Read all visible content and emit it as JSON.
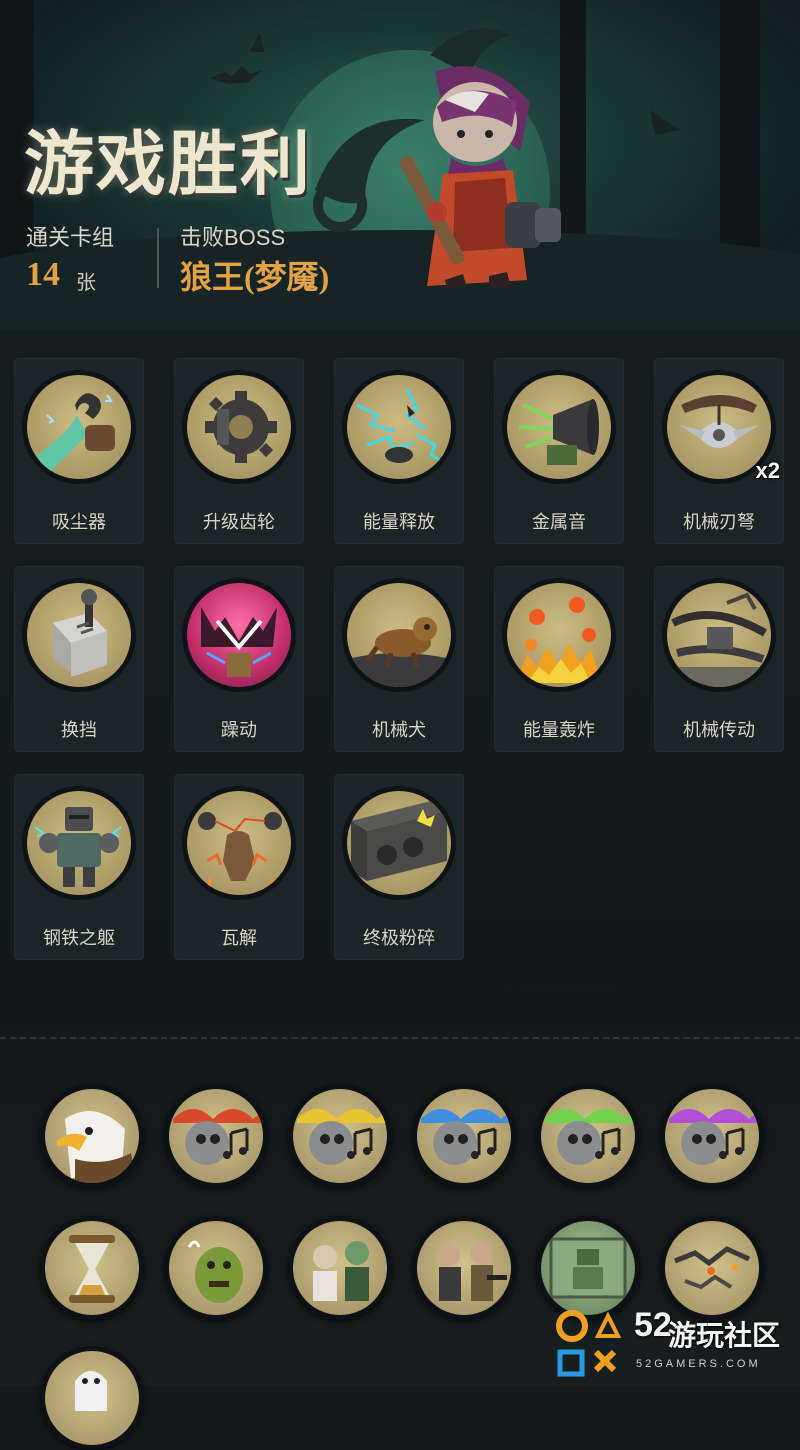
{
  "header": {
    "title": "游戏胜利",
    "deck_label": "通关卡组",
    "deck_count": "14",
    "deck_unit": "张",
    "boss_label": "击败BOSS",
    "boss_name": "狼王(梦魇)"
  },
  "cards": [
    {
      "name": "吸尘器",
      "icon": "vacuum-icon"
    },
    {
      "name": "升级齿轮",
      "icon": "gear-icon"
    },
    {
      "name": "能量释放",
      "icon": "energy-release-icon"
    },
    {
      "name": "金属音",
      "icon": "metal-horn-icon"
    },
    {
      "name": "机械刃弩",
      "icon": "blade-crossbow-icon",
      "badge": "x2"
    },
    {
      "name": "换挡",
      "icon": "gear-shift-icon"
    },
    {
      "name": "躁动",
      "icon": "frenzy-icon"
    },
    {
      "name": "机械犬",
      "icon": "mech-dog-icon"
    },
    {
      "name": "能量轰炸",
      "icon": "energy-bombard-icon"
    },
    {
      "name": "机械传动",
      "icon": "mech-transmission-icon"
    },
    {
      "name": "钢铁之躯",
      "icon": "steel-body-icon"
    },
    {
      "name": "瓦解",
      "icon": "disintegrate-icon"
    },
    {
      "name": "终极粉碎",
      "icon": "ultimate-crush-icon"
    }
  ],
  "relics": [
    {
      "icon": "eagle-icon"
    },
    {
      "icon": "music-skull-red-icon",
      "color": "#d84a2a"
    },
    {
      "icon": "music-skull-yellow-icon",
      "color": "#e9c431"
    },
    {
      "icon": "music-skull-blue-icon",
      "color": "#3f8ee0"
    },
    {
      "icon": "music-skull-green-icon",
      "color": "#6fd24a"
    },
    {
      "icon": "music-skull-purple-icon",
      "color": "#b34fd6"
    },
    {
      "icon": "hourglass-icon"
    },
    {
      "icon": "ogre-icon"
    },
    {
      "icon": "zombie-duo-icon"
    },
    {
      "icon": "gunmen-icon"
    },
    {
      "icon": "robot-screen-icon"
    },
    {
      "icon": "spark-crack-icon"
    },
    {
      "icon": "ghost-icon"
    }
  ],
  "watermark": {
    "number": "52",
    "text": "游玩社区",
    "sub": "52GAMERS.COM"
  },
  "colors": {
    "accent_orange": "#e4a247",
    "card_bg": "#1b2427",
    "icon_tan": "#a89764"
  }
}
